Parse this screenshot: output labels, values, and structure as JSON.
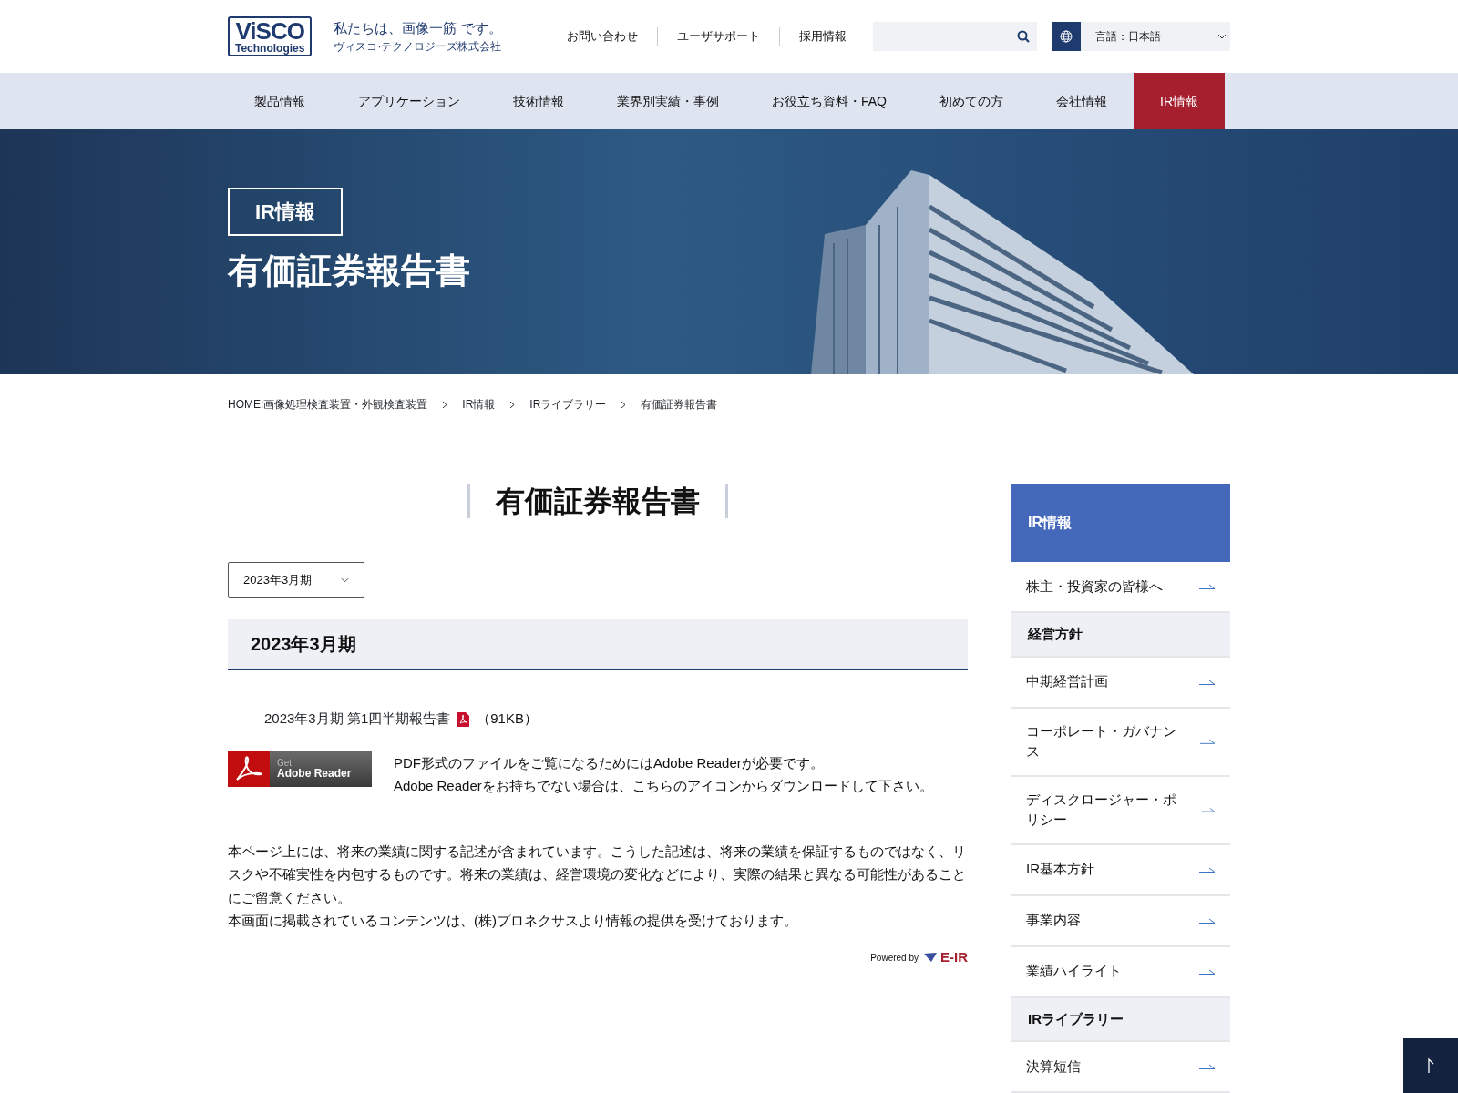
{
  "header": {
    "logo": {
      "line1": "ViSCO",
      "line2": "Technologies"
    },
    "tagline": "私たちは、画像一筋 です。",
    "company": "ヴィスコ·テクノロジーズ株式会社",
    "links": [
      "お問い合わせ",
      "ユーザサポート",
      "採用情報"
    ],
    "language": "言語：日本語"
  },
  "nav": [
    {
      "label": "製品情報",
      "selected": false
    },
    {
      "label": "アプリケーション",
      "selected": false
    },
    {
      "label": "技術情報",
      "selected": false
    },
    {
      "label": "業界別実績・事例",
      "selected": false
    },
    {
      "label": "お役立ち資料・FAQ",
      "selected": false
    },
    {
      "label": "初めての方",
      "selected": false
    },
    {
      "label": "会社情報",
      "selected": false
    },
    {
      "label": "IR情報",
      "selected": true
    }
  ],
  "hero": {
    "badge": "IR情報",
    "title": "有価証券報告書"
  },
  "breadcrumb": [
    "HOME:画像処理検査装置・外観検査装置",
    "IR情報",
    "IRライブラリー",
    "有価証券報告書"
  ],
  "main": {
    "title": "有価証券報告書",
    "period_select": "2023年3月期",
    "section_heading": "2023年3月期",
    "documents": [
      {
        "label": "2023年3月期 第1四半期報告書",
        "size": "（91KB）"
      }
    ],
    "adobe": {
      "badge_small": "Get",
      "badge_large": "Adobe Reader",
      "lines": [
        "PDF形式のファイルをご覧になるためにはAdobe Readerが必要です。",
        "Adobe Readerをお持ちでない場合は、こちらのアイコンからダウンロードして下さい。"
      ]
    },
    "disclaimer": [
      "本ページ上には、将来の業績に関する記述が含まれています。こうした記述は、将来の業績を保証するものではなく、リスクや不確実性を内包するものです。将来の業績は、経営環境の変化などにより、実際の結果と異なる可能性があることにご留意ください。",
      "本画面に掲載されているコンテンツは、(株)プロネクサスより情報の提供を受けております。"
    ],
    "powered_by": {
      "label": "Powered by",
      "brand": "E-IR"
    }
  },
  "sidebar": {
    "title": "IR情報",
    "items": [
      {
        "kind": "link",
        "label": "株主・投資家の皆様へ"
      },
      {
        "kind": "heading",
        "label": "経営方針"
      },
      {
        "kind": "link",
        "label": "中期経営計画"
      },
      {
        "kind": "link",
        "label": "コーポレート・ガバナンス"
      },
      {
        "kind": "link",
        "label": "ディスクロージャー・ポリシー"
      },
      {
        "kind": "link",
        "label": "IR基本方針"
      },
      {
        "kind": "link",
        "label": "事業内容"
      },
      {
        "kind": "link",
        "label": "業績ハイライト"
      },
      {
        "kind": "heading",
        "label": "IRライブラリー"
      },
      {
        "kind": "link",
        "label": "決算短信"
      }
    ]
  }
}
